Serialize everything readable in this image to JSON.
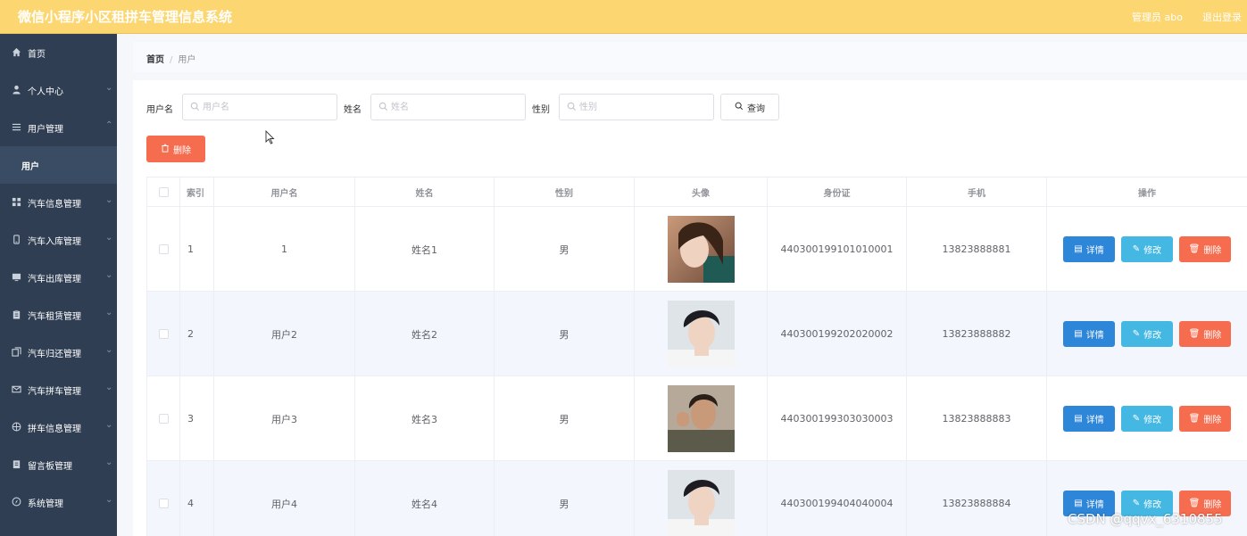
{
  "app": {
    "title": "微信小程序小区租拼车管理信息系统",
    "admin_label": "管理员 abo",
    "logout_label": "退出登录"
  },
  "sidebar": {
    "items": [
      {
        "label": "首页",
        "icon": "home-icon"
      },
      {
        "label": "个人中心",
        "icon": "user-icon"
      },
      {
        "label": "用户管理",
        "icon": "list-icon"
      },
      {
        "label": "用户",
        "icon": ""
      },
      {
        "label": "汽车信息管理",
        "icon": "grid-icon"
      },
      {
        "label": "汽车入库管理",
        "icon": "mobile-icon"
      },
      {
        "label": "汽车出库管理",
        "icon": "monitor-icon"
      },
      {
        "label": "汽车租赁管理",
        "icon": "clipboard-icon"
      },
      {
        "label": "汽车归还管理",
        "icon": "copy-icon"
      },
      {
        "label": "汽车拼车管理",
        "icon": "mail-icon"
      },
      {
        "label": "拼车信息管理",
        "icon": "globe-icon"
      },
      {
        "label": "留言板管理",
        "icon": "note-icon"
      },
      {
        "label": "系统管理",
        "icon": "compass-icon"
      }
    ]
  },
  "breadcrumb": {
    "home": "首页",
    "separator": "/",
    "current": "用户"
  },
  "filters": {
    "username_label": "用户名",
    "username_placeholder": "用户名",
    "name_label": "姓名",
    "name_placeholder": "姓名",
    "gender_label": "性别",
    "gender_placeholder": "性别",
    "query_label": "查询",
    "delete_label": "删除"
  },
  "table": {
    "headers": [
      "索引",
      "用户名",
      "姓名",
      "性别",
      "头像",
      "身份证",
      "手机",
      "操作"
    ],
    "rows": [
      {
        "index": "1",
        "username": "1",
        "name": "姓名1",
        "gender": "男",
        "id_card": "440300199101010001",
        "phone": "13823888881"
      },
      {
        "index": "2",
        "username": "用户2",
        "name": "姓名2",
        "gender": "男",
        "id_card": "440300199202020002",
        "phone": "13823888882"
      },
      {
        "index": "3",
        "username": "用户3",
        "name": "姓名3",
        "gender": "男",
        "id_card": "440300199303030003",
        "phone": "13823888883"
      },
      {
        "index": "4",
        "username": "用户4",
        "name": "姓名4",
        "gender": "男",
        "id_card": "440300199404040004",
        "phone": "13823888884"
      }
    ],
    "actions": {
      "detail": "详情",
      "edit": "修改",
      "delete": "删除"
    }
  },
  "colors": {
    "topbar": "#fcd671",
    "sidebar": "#2f3e52",
    "detail_button": "#2d86d8",
    "edit_button": "#44b8e2",
    "delete_button": "#f56c4f"
  },
  "watermark": "CSDN @qqvx_6310855"
}
